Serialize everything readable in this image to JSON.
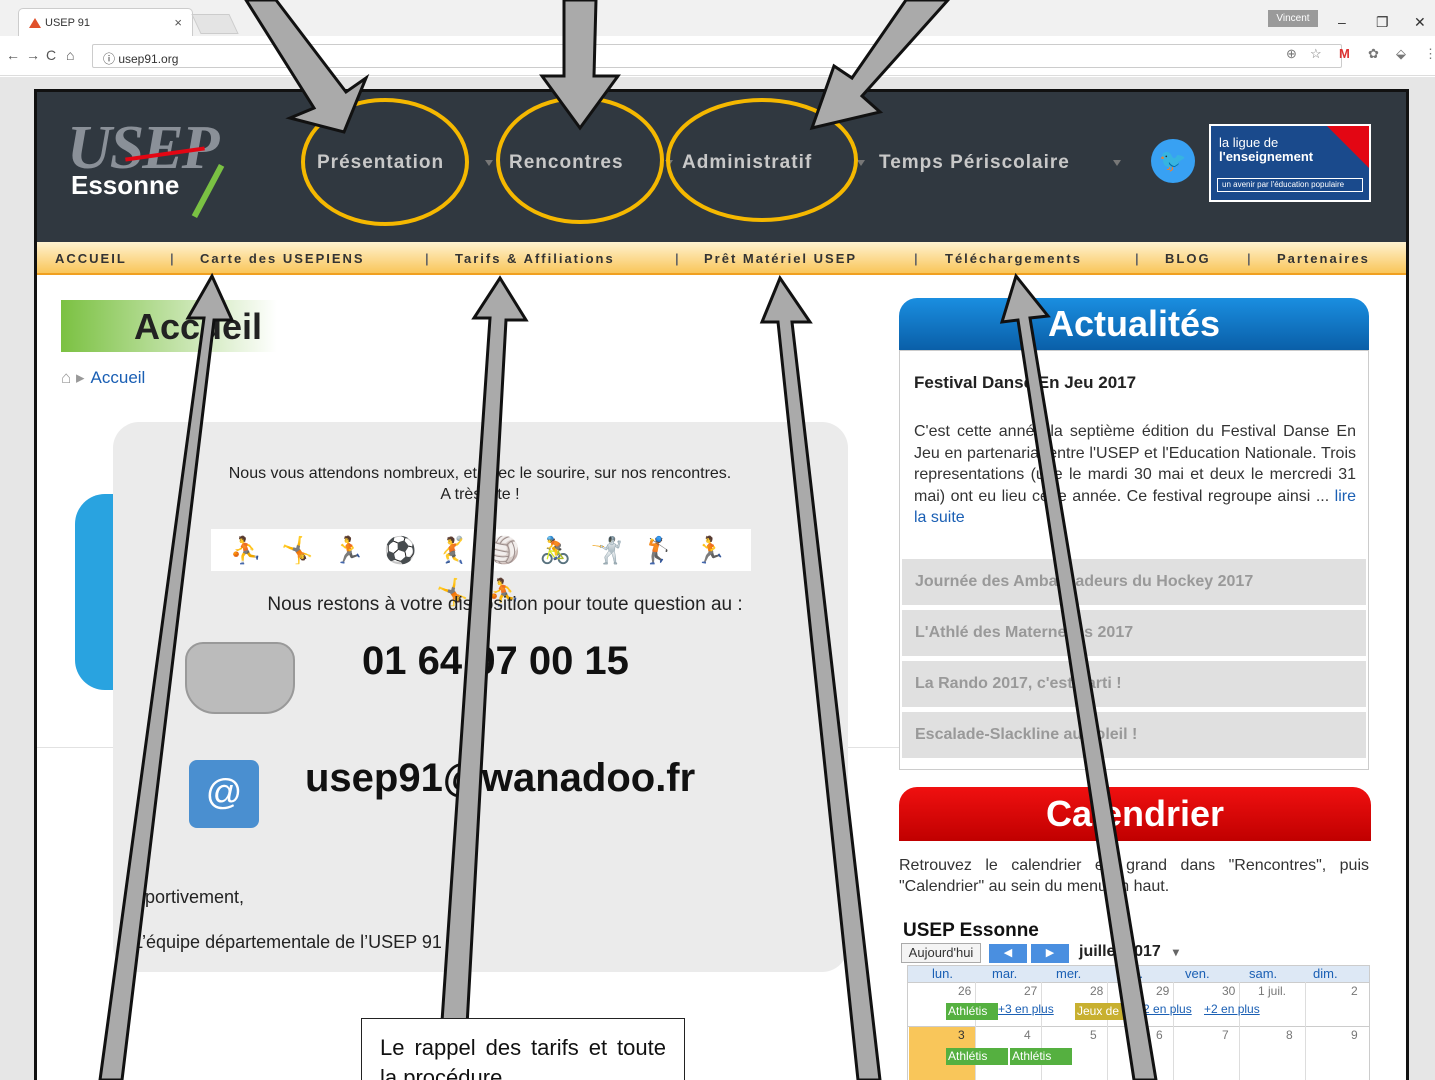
{
  "browser": {
    "tab_title": "USEP 91",
    "tab_close": "×",
    "user_label": "Vincent",
    "minimize": "–",
    "restore": "❐",
    "close": "✕",
    "back": "←",
    "forward": "→",
    "reload": "C",
    "home": "⌂",
    "url": "ⓘ usep91.org",
    "ext_zoom": "⊕",
    "ext_star": "☆",
    "ext_gmail": "M",
    "ext_a": "✿",
    "ext_b": "⬙",
    "ext_menu": "⋮"
  },
  "site": {
    "logo": {
      "name": "USEP",
      "sub": "Essonne"
    },
    "main_nav": [
      "Présentation",
      "Rencontres",
      "Administratif",
      "Temps Périscolaire"
    ],
    "twitter_glyph": "🐦",
    "ligue": {
      "line1": "la ligue de",
      "line2": "l'enseignement",
      "tagline": "un avenir par l'éducation populaire"
    },
    "sub_nav": [
      "ACCUEIL",
      "Carte des USEPIENS",
      "Tarifs & Affiliations",
      "Prêt Matériel USEP",
      "Téléchargements",
      "BLOG",
      "Partenaires"
    ],
    "sub_nav_sep": "|",
    "page_title": "Accueil",
    "breadcrumb_home": "⌂ ▸",
    "breadcrumb": "Accueil",
    "welcome": {
      "line1": "Nous vous attendons nombreux, et avec le sourire, sur nos rencontres.",
      "line2": "A très vite !",
      "figures": "⛹ 🤸 🏃 ⚽ 🤾 🏐 🚴 🤺 🏌 🏃 🤸 ⛹",
      "info": "Nous restons à votre disposition pour toute question au :",
      "phone": "01 64 97 00 15",
      "email": "usep91@wanadoo.fr",
      "mail_glyph": "@",
      "sign1": "Sportivement,",
      "sign2": "L’équipe départementale de l’USEP 91"
    },
    "news": {
      "heading": "Actualités",
      "featured_title": "Festival Danse En Jeu 2017",
      "featured_body": "C'est cette année la septième édition du Festival Danse En Jeu en partenariat entre l'USEP et l'Education Nationale. Trois representations (une le mardi 30 mai et deux le mercredi 31 mai) ont eu lieu cette année. Ce festival regroupe ainsi ...",
      "read_more": "lire la suite",
      "items": [
        "Journée des Ambassadeurs du Hockey 2017",
        "L'Athlé des Maternelles 2017",
        "La Rando 2017, c'est parti !",
        "Escalade-Slackline au soleil !"
      ]
    },
    "calendar": {
      "heading": "Calendrier",
      "text": "Retrouvez le calendrier en grand dans \"Rencontres\", puis \"Calendrier\" au sein du menu en haut.",
      "title": "USEP Essonne",
      "today_btn": "Aujourd'hui",
      "prev": "◀",
      "next": "▶",
      "month": "juillet 2017",
      "caret": "▾",
      "days": [
        "lun.",
        "mar.",
        "mer.",
        "jeu.",
        "ven.",
        "sam.",
        "dim."
      ],
      "week1": [
        "26",
        "27",
        "28",
        "29",
        "30",
        "1 juil.",
        "2"
      ],
      "week2": [
        "3",
        "4",
        "5",
        "6",
        "7",
        "8",
        "9"
      ],
      "events_w1": {
        "e1": "Athlétis",
        "m1": "+3 en plus",
        "e2": "Jeux de",
        "m2": "+2 en plus",
        "m3": "+2 en plus"
      },
      "events_w2": {
        "e1": "Athlétis",
        "e2": "Athlétis"
      }
    }
  },
  "annotation": {
    "note": "Le rappel des tarifs et toute la procédure"
  }
}
